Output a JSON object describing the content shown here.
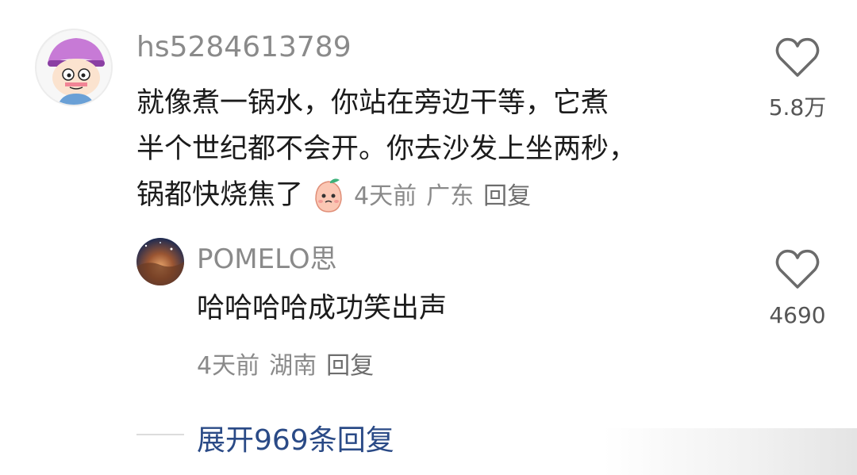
{
  "comment": {
    "username": "hs5284613789",
    "text_line1": "就像煮一锅水，你站在旁边干等，它煮",
    "text_line2": "半个世纪都不会开。你去沙发上坐两秒，",
    "text_line3": "锅都快烧焦了",
    "time": "4天前",
    "location": "广东",
    "reply_label": "回复",
    "like_count": "5.8万"
  },
  "reply": {
    "username": "POMELO思",
    "text": "哈哈哈哈成功笑出声",
    "time": "4天前",
    "location": "湖南",
    "reply_label": "回复",
    "like_count": "4690"
  },
  "expand": {
    "label": "展开969条回复"
  },
  "icons": {
    "like": "heart-outline-icon",
    "emoji": "peach-face-emoji-icon"
  },
  "colors": {
    "link_blue": "#2a4a86",
    "meta_gray": "#8a8a8a"
  }
}
